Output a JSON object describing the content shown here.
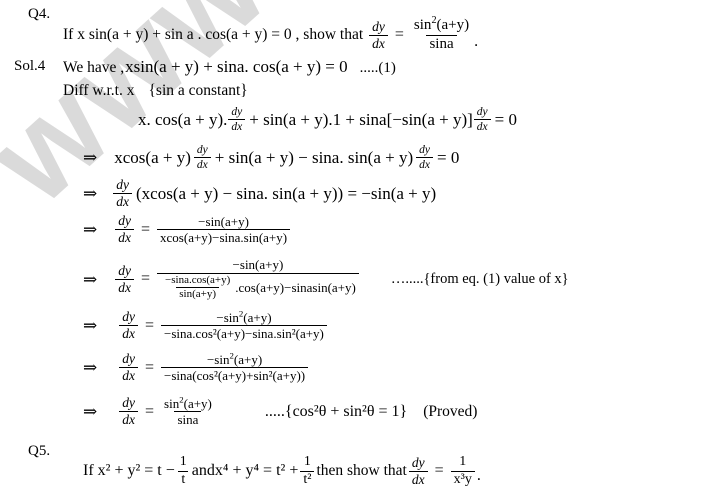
{
  "document": {
    "type": "math-solution-page",
    "watermark_text": "www.tu",
    "watermark_color": "#d9d9d9",
    "text_color": "#000000",
    "background_color": "#ffffff"
  },
  "q4": {
    "label": "Q4.",
    "statement_prefix": "If x sin(a + y) + sin a . cos(a + y) = 0 , show that",
    "result": {
      "lhs_num": "dy",
      "lhs_den": "dx",
      "rhs_num": "sin",
      "rhs_num_sup": "2",
      "rhs_num_arg": "(a+y)",
      "rhs_den": "sina",
      "period": "."
    }
  },
  "sol4": {
    "label": "Sol.4",
    "line1": {
      "prefix": "We have ,",
      "expr": "xsin(a + y) + sina. cos(a + y) = 0",
      "eqnum": ".....(1)"
    },
    "line2": {
      "text": "Diff  w.r.t.  x",
      "brace": "{sin a constant}"
    },
    "line3": {
      "part1": "x. cos(a + y).",
      "dydx_num": "dy",
      "dydx_den": "dx",
      "part2": "+ sin(a + y).1 + sina[",
      "part3": "−sin(a + y)]",
      "dydx2_num": "dy",
      "dydx2_den": "dx",
      "part4": "= 0"
    },
    "line4": {
      "arrow": "⇒",
      "part1": "xcos(a + y)",
      "dydx_num": "dy",
      "dydx_den": "dx",
      "part2": "+ sin(a + y) − sina. sin(a + y)",
      "dydx2_num": "dy",
      "dydx2_den": "dx",
      "part3": "= 0"
    },
    "line5": {
      "arrow": "⇒",
      "dydx_num": "dy",
      "dydx_den": "dx",
      "expr": "(xcos(a + y) − sina. sin(a + y)) = −sin(a + y)"
    },
    "line6": {
      "arrow": "⇒",
      "dydx_num": "dy",
      "dydx_den": "dx",
      "eq": "=",
      "num": "−sin(a+y)",
      "den": "xcos(a+y)−sina.sin(a+y)"
    },
    "line7": {
      "arrow": "⇒",
      "dydx_num": "dy",
      "dydx_den": "dx",
      "eq": "=",
      "num": "−sin(a+y)",
      "den_inner_num": "−sina.cos(a+y)",
      "den_inner_den": "sin(a+y)",
      "den_rest": ".cos(a+y)−sinasin(a+y)",
      "note": "….....{from eq. (1) value of x}"
    },
    "line8": {
      "arrow": "⇒",
      "dydx_num": "dy",
      "dydx_den": "dx",
      "eq": "=",
      "num_pre": "−sin",
      "num_sup": "2",
      "num_post": "(a+y)",
      "den": "−sina.cos²(a+y)−sina.sin²(a+y)"
    },
    "line9": {
      "arrow": "⇒",
      "dydx_num": "dy",
      "dydx_den": "dx",
      "eq": "=",
      "num_pre": "−sin",
      "num_sup": "2",
      "num_post": "(a+y)",
      "den": "−sina(cos²(a+y)+sin²(a+y))"
    },
    "line10": {
      "arrow": "⇒",
      "dydx_num": "dy",
      "dydx_den": "dx",
      "eq": "=",
      "num_pre": "sin",
      "num_sup": "2",
      "num_post": "(a+y)",
      "den": "sina",
      "identity": ".....{cos²θ + sin²θ = 1}",
      "proved": "(Proved)"
    }
  },
  "q5": {
    "label": "Q5.",
    "part1": "If x² + y² = t −",
    "frac1_num": "1",
    "frac1_den": "t",
    "part2": "andx⁴ + y⁴ = t² +",
    "frac2_num": "1",
    "frac2_den": "t²",
    "part3": "then show that",
    "frac3_num": "dy",
    "frac3_den": "dx",
    "eq": "=",
    "frac4_num": "1",
    "frac4_den": "x³y",
    "period": "."
  }
}
